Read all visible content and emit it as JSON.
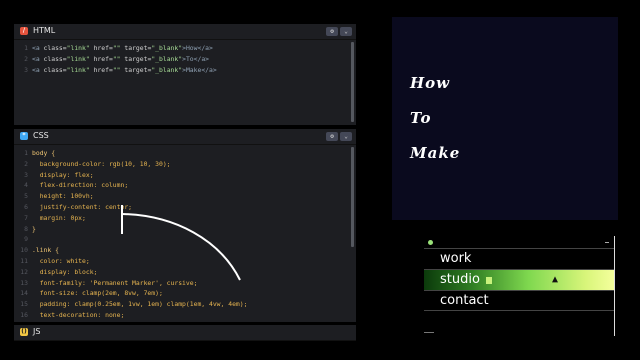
{
  "panels": {
    "html": {
      "title": "HTML",
      "badge": "/",
      "badge_color": "#e5533d"
    },
    "css": {
      "title": "CSS",
      "badge": "*",
      "badge_color": "#3fa9f5"
    },
    "js": {
      "title": "JS",
      "badge": "()",
      "badge_color": "#f2c744"
    }
  },
  "header_buttons": {
    "settings": "⚙",
    "collapse": "⌄"
  },
  "html_lines": [
    {
      "n": "1",
      "pre": "<a ",
      "a1": "class=",
      "v1": "\"link\"",
      "a2": " href=",
      "v2": "\"\"",
      "a3": " target=",
      "v3": "\"_blank\"",
      "txt": ">How</a>"
    },
    {
      "n": "2",
      "pre": "<a ",
      "a1": "class=",
      "v1": "\"link\"",
      "a2": " href=",
      "v2": "\"\"",
      "a3": " target=",
      "v3": "\"_blank\"",
      "txt": ">To</a>"
    },
    {
      "n": "3",
      "pre": "<a ",
      "a1": "class=",
      "v1": "\"link\"",
      "a2": " href=",
      "v2": "\"\"",
      "a3": " target=",
      "v3": "\"_blank\"",
      "txt": ">Make</a>"
    }
  ],
  "css_lines": [
    {
      "n": "1",
      "text": "body {"
    },
    {
      "n": "2",
      "text": "  background-color: rgb(10, 10, 30);"
    },
    {
      "n": "3",
      "text": "  display: flex;"
    },
    {
      "n": "4",
      "text": "  flex-direction: column;"
    },
    {
      "n": "5",
      "text": "  height: 100vh;"
    },
    {
      "n": "6",
      "text": "  justify-content: center;"
    },
    {
      "n": "7",
      "text": "  margin: 0px;"
    },
    {
      "n": "8",
      "text": "}"
    },
    {
      "n": "9",
      "text": ""
    },
    {
      "n": "10",
      "text": ".link {"
    },
    {
      "n": "11",
      "text": "  color: white;"
    },
    {
      "n": "12",
      "text": "  display: block;"
    },
    {
      "n": "13",
      "text": "  font-family: 'Permanent Marker', cursive;"
    },
    {
      "n": "14",
      "text": "  font-size: clamp(2em, 8vw, 7em);"
    },
    {
      "n": "15",
      "text": "  padding: clamp(0.25em, 1vw, 1em) clamp(1em, 4vw, 4em);"
    },
    {
      "n": "16",
      "text": "  text-decoration: none;"
    }
  ],
  "preview": {
    "words": [
      "How",
      "To",
      "Make"
    ],
    "background": "#0a0a1e"
  },
  "mini_menu": {
    "items": [
      "work",
      "studio",
      "contact"
    ],
    "active_index": 1,
    "accent": "#7fd84f"
  }
}
